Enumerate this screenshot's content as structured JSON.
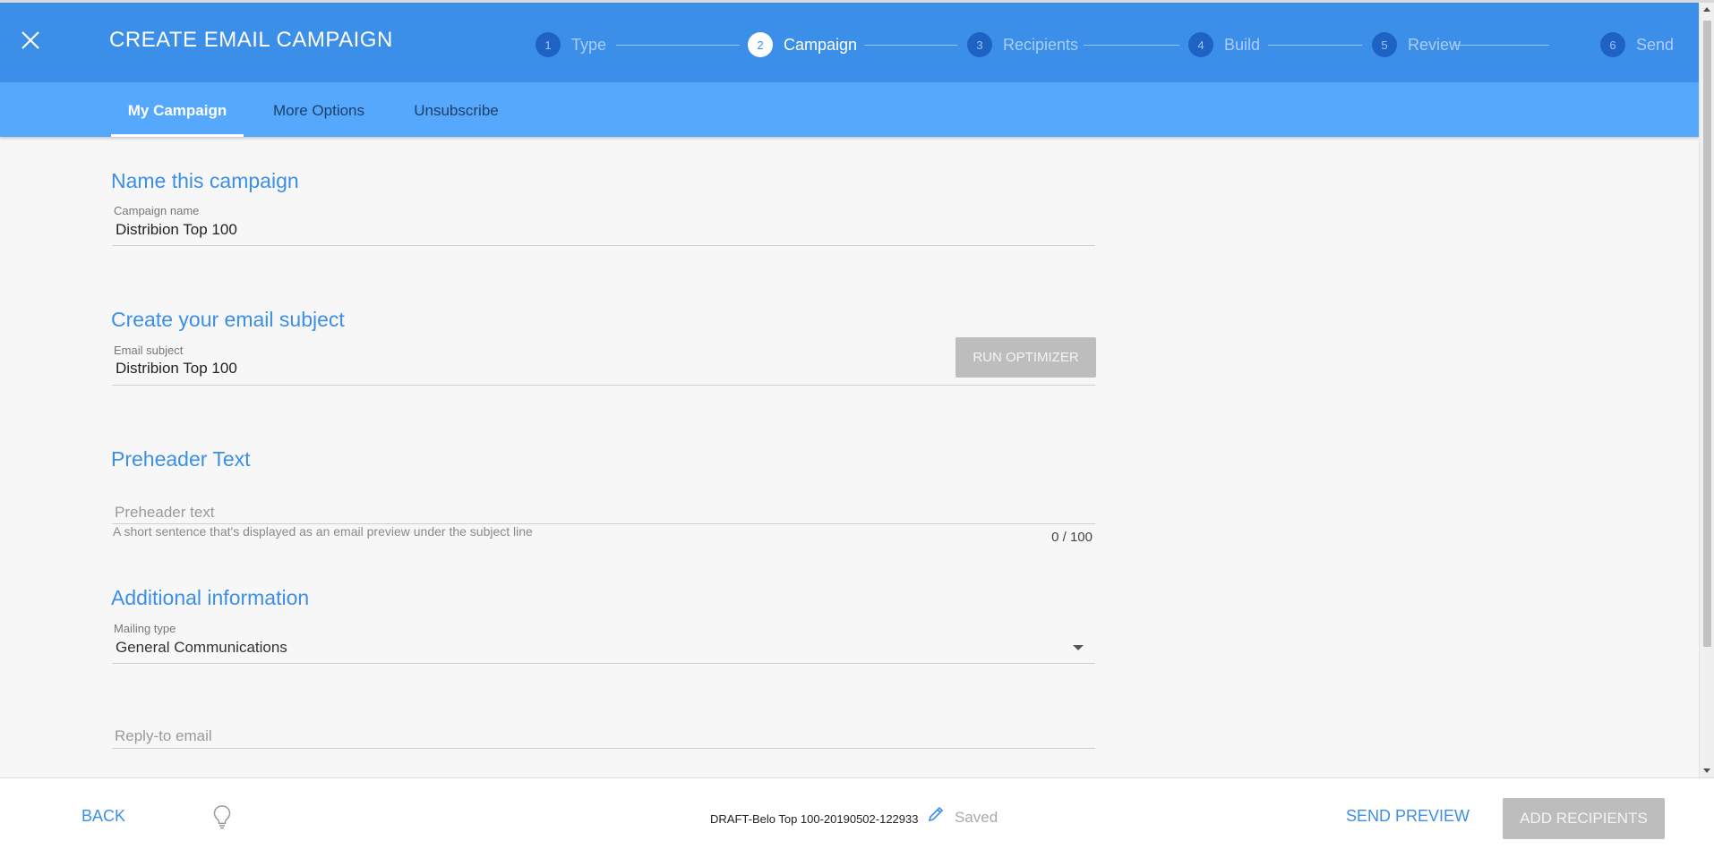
{
  "header": {
    "title": "CREATE EMAIL CAMPAIGN",
    "steps": [
      {
        "num": "1",
        "label": "Type"
      },
      {
        "num": "2",
        "label": "Campaign"
      },
      {
        "num": "3",
        "label": "Recipients"
      },
      {
        "num": "4",
        "label": "Build"
      },
      {
        "num": "5",
        "label": "Review"
      },
      {
        "num": "6",
        "label": "Send"
      }
    ],
    "active_step": "2"
  },
  "tabs": [
    {
      "label": "My Campaign"
    },
    {
      "label": "More Options"
    },
    {
      "label": "Unsubscribe"
    }
  ],
  "sections": {
    "name": {
      "title": "Name this campaign",
      "field_label": "Campaign name",
      "value": "Distribion Top 100"
    },
    "subject": {
      "title": "Create your email subject",
      "field_label": "Email subject",
      "value": "Distribion Top 100",
      "optimizer_button": "RUN OPTIMIZER"
    },
    "preheader": {
      "title": "Preheader Text",
      "placeholder": "Preheader text",
      "hint": "A short sentence that's displayed as an email preview under the subject line",
      "counter": "0 / 100"
    },
    "additional": {
      "title": "Additional information",
      "mailing_type_label": "Mailing type",
      "mailing_type_value": "General Communications",
      "reply_to_placeholder": "Reply-to email"
    }
  },
  "footer": {
    "back": "BACK",
    "draft_name": "DRAFT-Belo Top 100-20190502-122933",
    "saved": "Saved",
    "send_preview": "SEND PREVIEW",
    "add_recipients": "ADD RECIPIENTS"
  },
  "colors": {
    "header": "#3c8fe8",
    "subtabs": "#56a8fd",
    "accent": "#3c8fe8"
  }
}
